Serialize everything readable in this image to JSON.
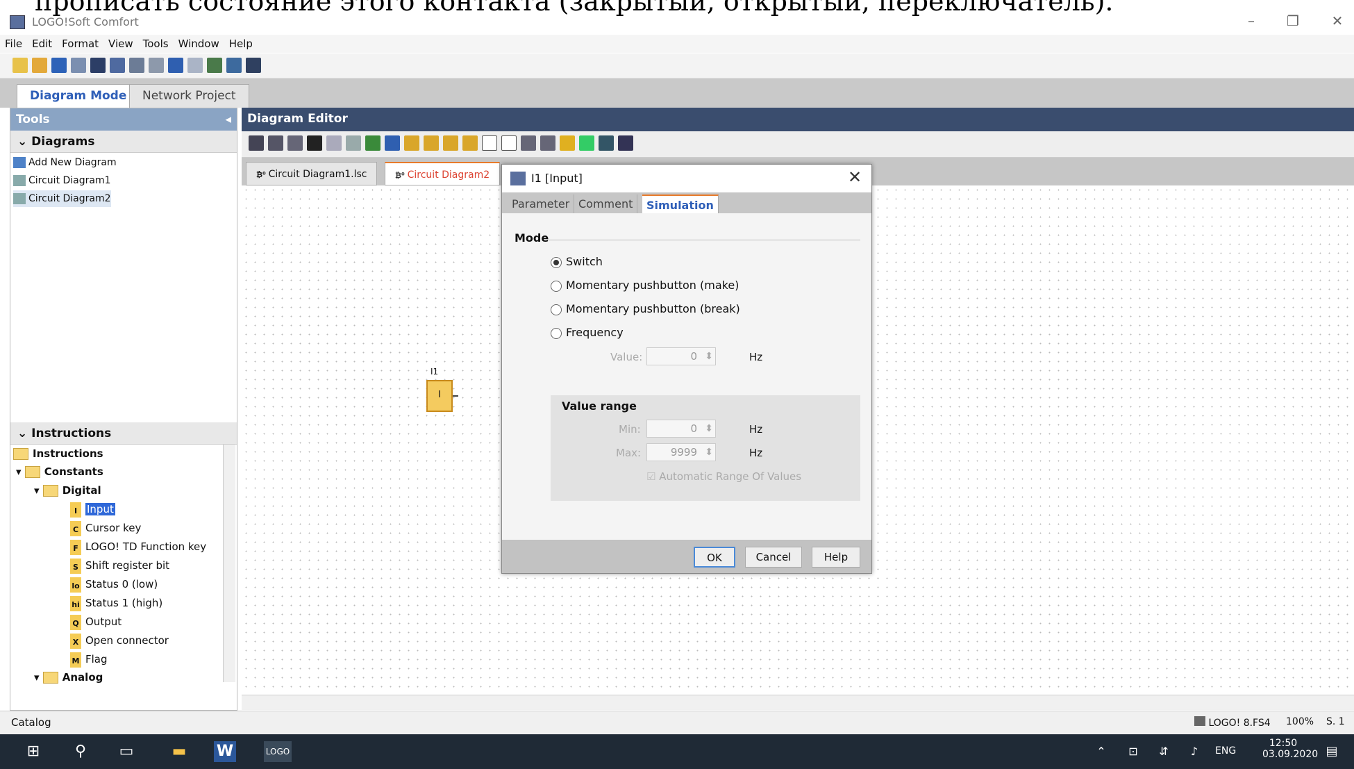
{
  "overlay_text": "прописать состояние этого контакта (закрытый, открытый, переключатель).",
  "window": {
    "title": "LOGO!Soft Comfort"
  },
  "menu": [
    "File",
    "Edit",
    "Format",
    "View",
    "Tools",
    "Window",
    "Help"
  ],
  "modes": {
    "diagram": "Diagram Mode",
    "network": "Network Project"
  },
  "tools": {
    "header": "Tools",
    "diagrams_header": "Diagrams",
    "diagrams": [
      "Add New Diagram",
      "Circuit Diagram1",
      "Circuit Diagram2"
    ],
    "instructions_header": "Instructions",
    "tree": {
      "instructions": "Instructions",
      "constants": "Constants",
      "digital": "Digital",
      "items": [
        {
          "tag": "I",
          "label": "Input"
        },
        {
          "tag": "C",
          "label": "Cursor key"
        },
        {
          "tag": "F",
          "label": "LOGO! TD Function key"
        },
        {
          "tag": "S",
          "label": "Shift register bit"
        },
        {
          "tag": "lo",
          "label": "Status 0 (low)"
        },
        {
          "tag": "hi",
          "label": "Status 1 (high)"
        },
        {
          "tag": "Q",
          "label": "Output"
        },
        {
          "tag": "X",
          "label": "Open connector"
        },
        {
          "tag": "M",
          "label": "Flag"
        }
      ],
      "analog": "Analog"
    }
  },
  "editor": {
    "header": "Diagram Editor",
    "tabs": [
      "Circuit Diagram1.lsc",
      "Circuit Diagram2"
    ],
    "block_label": "I1",
    "block_text": "I"
  },
  "dialog": {
    "title": "I1 [Input]",
    "tabs": [
      "Parameter",
      "Comment",
      "Simulation"
    ],
    "mode_label": "Mode",
    "options": [
      "Switch",
      "Momentary pushbutton (make)",
      "Momentary pushbutton (break)",
      "Frequency"
    ],
    "selected": "Switch",
    "value_label": "Value:",
    "value": "0",
    "hz": "Hz",
    "range_label": "Value range",
    "min_label": "Min:",
    "min": "0",
    "max_label": "Max:",
    "max": "9999",
    "auto_range": "Automatic Range Of Values",
    "ok": "OK",
    "cancel": "Cancel",
    "help": "Help"
  },
  "status": {
    "left": "Catalog",
    "device": "LOGO! 8.FS4",
    "zoom": "100%",
    "page": "S. 1"
  },
  "taskbar": {
    "lang": "ENG",
    "time": "12:50",
    "date": "03.09.2020"
  }
}
